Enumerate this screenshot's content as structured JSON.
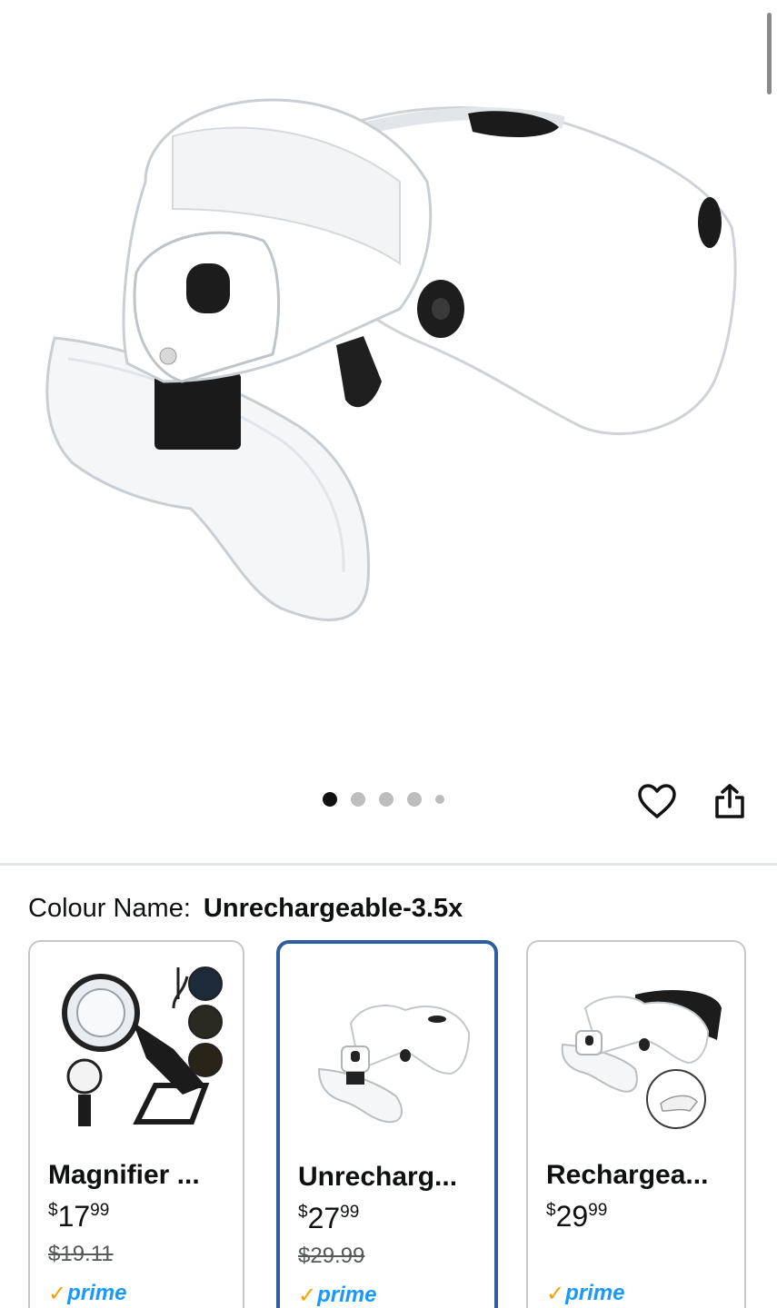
{
  "product": {
    "image_icon": "head-magnifier-glasses-image",
    "carousel": {
      "count": 5,
      "active_index": 0
    },
    "actions": {
      "favorite_icon": "heart-icon",
      "share_icon": "share-icon"
    }
  },
  "variant_selector": {
    "label": "Colour Name:",
    "selected_value": "Unrechargeable-3.5x",
    "options": [
      {
        "title": "Magnifier ...",
        "price_symbol": "$",
        "price_whole": "17",
        "price_cents": "99",
        "list_price": "$19.11",
        "prime_label": "prime",
        "thumb_icon": "handheld-magnifier-thumbnail",
        "selected": false
      },
      {
        "title": "Unrecharg...",
        "price_symbol": "$",
        "price_whole": "27",
        "price_cents": "99",
        "list_price": "$29.99",
        "prime_label": "prime",
        "thumb_icon": "head-magnifier-thumbnail",
        "selected": true
      },
      {
        "title": "Rechargea...",
        "price_symbol": "$",
        "price_whole": "29",
        "price_cents": "99",
        "list_price": "",
        "prime_label": "prime",
        "thumb_icon": "rechargeable-head-magnifier-thumbnail",
        "selected": false
      }
    ]
  },
  "colors": {
    "selected_border": "#2d5d9f",
    "prime_blue": "#1a98ff",
    "prime_check": "#f7a000"
  }
}
